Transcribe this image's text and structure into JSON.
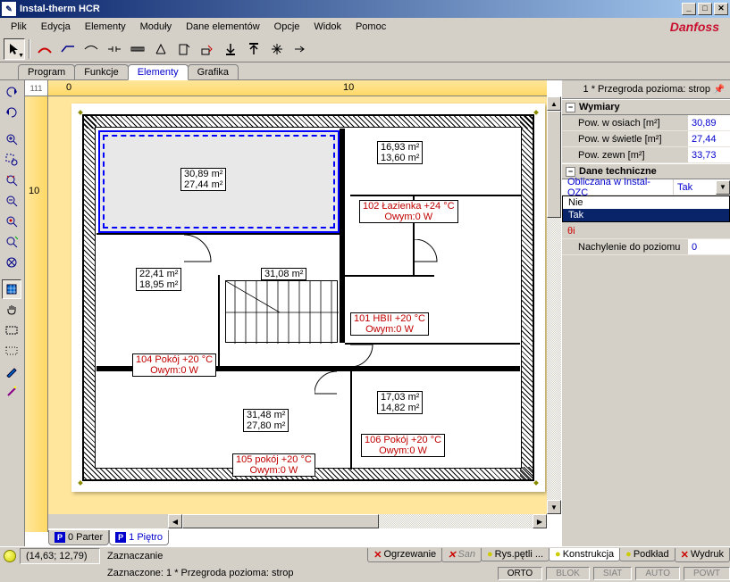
{
  "window": {
    "title": "Instal-therm HCR",
    "brand": "Danfoss"
  },
  "menu": [
    "Plik",
    "Edycja",
    "Elementy",
    "Moduły",
    "Dane elementów",
    "Opcje",
    "Widok",
    "Pomoc"
  ],
  "tabs": {
    "items": [
      "Program",
      "Funkcje",
      "Elementy",
      "Grafika"
    ],
    "active": 2
  },
  "ruler": {
    "corner": "111",
    "h0": "0",
    "h10": "10",
    "v10": "10"
  },
  "floor_tabs": {
    "items": [
      "0 Parter",
      "1 Piętro"
    ],
    "active": 1
  },
  "rooms": {
    "sel": {
      "area1": "30,89 m²",
      "area2": "27,44 m²"
    },
    "r1": {
      "area1": "16,93 m²",
      "area2": "13,60 m²"
    },
    "r2": {
      "name": "102 Łazienka +24 °C",
      "ow": "Owym:0 W"
    },
    "r3": {
      "area1": "22,41 m²",
      "area2": "18,95 m²"
    },
    "r4": {
      "name": "104 Pokój +20 °C",
      "ow": "Owym:0 W"
    },
    "r5": {
      "area": "31,08 m²"
    },
    "r6": {
      "name": "101 HBII +20 °C",
      "ow": "Owym:0 W"
    },
    "r7": {
      "area1": "31,48 m²",
      "area2": "27,80 m²"
    },
    "r8": {
      "name": "105 pokój +20 °C",
      "ow": "Owym:0 W"
    },
    "r9": {
      "area1": "17,03 m²",
      "area2": "14,82 m²"
    },
    "r10": {
      "name": "106 Pokój +20 °C",
      "ow": "Owym:0 W"
    }
  },
  "props": {
    "header": "1 * Przegroda pozioma: strop",
    "sections": {
      "wymiary": {
        "title": "Wymiary",
        "rows": [
          {
            "label": "Pow. w osiach [m²]",
            "value": "30,89"
          },
          {
            "label": "Pow. w świetle [m²]",
            "value": "27,44"
          },
          {
            "label": "Pow. zewn [m²]",
            "value": "33,73"
          }
        ]
      },
      "dane": {
        "title": "Dane techniczne",
        "editrow": {
          "label": "Obliczana w Instal-OZC",
          "value": "Tak"
        },
        "dropdown": [
          "Nie",
          "Tak"
        ],
        "dropdown_sel": 1,
        "below": {
          "label": "Nachylenie do poziomu",
          "value": "0",
          "extra": "θi"
        }
      }
    }
  },
  "status": {
    "coords": "(14,63; 12,79)",
    "mode_title": "Zaznaczanie",
    "selection": "Zaznaczone: 1 * Przegroda pozioma: strop",
    "bottom_tabs": [
      {
        "label": "Ogrzewanie",
        "icon": "x"
      },
      {
        "label": "San",
        "icon": "x",
        "disabled": true
      },
      {
        "label": "Rys.pętli ...",
        "icon": "bulb"
      },
      {
        "label": "Konstrukcja",
        "icon": "bulb",
        "active": true
      },
      {
        "label": "Podkład",
        "icon": "bulb"
      },
      {
        "label": "Wydruk",
        "icon": "x"
      }
    ],
    "modes": [
      "ORTO",
      "BLOK",
      "SIAT",
      "AUTO",
      "POWT"
    ],
    "modes_on": [
      0
    ]
  }
}
